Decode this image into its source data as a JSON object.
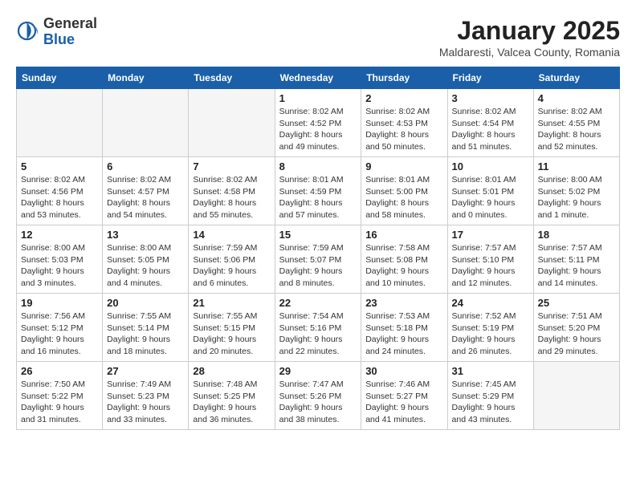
{
  "header": {
    "logo_general": "General",
    "logo_blue": "Blue",
    "month_title": "January 2025",
    "location": "Maldaresti, Valcea County, Romania"
  },
  "weekdays": [
    "Sunday",
    "Monday",
    "Tuesday",
    "Wednesday",
    "Thursday",
    "Friday",
    "Saturday"
  ],
  "weeks": [
    [
      {
        "day": "",
        "info": ""
      },
      {
        "day": "",
        "info": ""
      },
      {
        "day": "",
        "info": ""
      },
      {
        "day": "1",
        "info": "Sunrise: 8:02 AM\nSunset: 4:52 PM\nDaylight: 8 hours\nand 49 minutes."
      },
      {
        "day": "2",
        "info": "Sunrise: 8:02 AM\nSunset: 4:53 PM\nDaylight: 8 hours\nand 50 minutes."
      },
      {
        "day": "3",
        "info": "Sunrise: 8:02 AM\nSunset: 4:54 PM\nDaylight: 8 hours\nand 51 minutes."
      },
      {
        "day": "4",
        "info": "Sunrise: 8:02 AM\nSunset: 4:55 PM\nDaylight: 8 hours\nand 52 minutes."
      }
    ],
    [
      {
        "day": "5",
        "info": "Sunrise: 8:02 AM\nSunset: 4:56 PM\nDaylight: 8 hours\nand 53 minutes."
      },
      {
        "day": "6",
        "info": "Sunrise: 8:02 AM\nSunset: 4:57 PM\nDaylight: 8 hours\nand 54 minutes."
      },
      {
        "day": "7",
        "info": "Sunrise: 8:02 AM\nSunset: 4:58 PM\nDaylight: 8 hours\nand 55 minutes."
      },
      {
        "day": "8",
        "info": "Sunrise: 8:01 AM\nSunset: 4:59 PM\nDaylight: 8 hours\nand 57 minutes."
      },
      {
        "day": "9",
        "info": "Sunrise: 8:01 AM\nSunset: 5:00 PM\nDaylight: 8 hours\nand 58 minutes."
      },
      {
        "day": "10",
        "info": "Sunrise: 8:01 AM\nSunset: 5:01 PM\nDaylight: 9 hours\nand 0 minutes."
      },
      {
        "day": "11",
        "info": "Sunrise: 8:00 AM\nSunset: 5:02 PM\nDaylight: 9 hours\nand 1 minute."
      }
    ],
    [
      {
        "day": "12",
        "info": "Sunrise: 8:00 AM\nSunset: 5:03 PM\nDaylight: 9 hours\nand 3 minutes."
      },
      {
        "day": "13",
        "info": "Sunrise: 8:00 AM\nSunset: 5:05 PM\nDaylight: 9 hours\nand 4 minutes."
      },
      {
        "day": "14",
        "info": "Sunrise: 7:59 AM\nSunset: 5:06 PM\nDaylight: 9 hours\nand 6 minutes."
      },
      {
        "day": "15",
        "info": "Sunrise: 7:59 AM\nSunset: 5:07 PM\nDaylight: 9 hours\nand 8 minutes."
      },
      {
        "day": "16",
        "info": "Sunrise: 7:58 AM\nSunset: 5:08 PM\nDaylight: 9 hours\nand 10 minutes."
      },
      {
        "day": "17",
        "info": "Sunrise: 7:57 AM\nSunset: 5:10 PM\nDaylight: 9 hours\nand 12 minutes."
      },
      {
        "day": "18",
        "info": "Sunrise: 7:57 AM\nSunset: 5:11 PM\nDaylight: 9 hours\nand 14 minutes."
      }
    ],
    [
      {
        "day": "19",
        "info": "Sunrise: 7:56 AM\nSunset: 5:12 PM\nDaylight: 9 hours\nand 16 minutes."
      },
      {
        "day": "20",
        "info": "Sunrise: 7:55 AM\nSunset: 5:14 PM\nDaylight: 9 hours\nand 18 minutes."
      },
      {
        "day": "21",
        "info": "Sunrise: 7:55 AM\nSunset: 5:15 PM\nDaylight: 9 hours\nand 20 minutes."
      },
      {
        "day": "22",
        "info": "Sunrise: 7:54 AM\nSunset: 5:16 PM\nDaylight: 9 hours\nand 22 minutes."
      },
      {
        "day": "23",
        "info": "Sunrise: 7:53 AM\nSunset: 5:18 PM\nDaylight: 9 hours\nand 24 minutes."
      },
      {
        "day": "24",
        "info": "Sunrise: 7:52 AM\nSunset: 5:19 PM\nDaylight: 9 hours\nand 26 minutes."
      },
      {
        "day": "25",
        "info": "Sunrise: 7:51 AM\nSunset: 5:20 PM\nDaylight: 9 hours\nand 29 minutes."
      }
    ],
    [
      {
        "day": "26",
        "info": "Sunrise: 7:50 AM\nSunset: 5:22 PM\nDaylight: 9 hours\nand 31 minutes."
      },
      {
        "day": "27",
        "info": "Sunrise: 7:49 AM\nSunset: 5:23 PM\nDaylight: 9 hours\nand 33 minutes."
      },
      {
        "day": "28",
        "info": "Sunrise: 7:48 AM\nSunset: 5:25 PM\nDaylight: 9 hours\nand 36 minutes."
      },
      {
        "day": "29",
        "info": "Sunrise: 7:47 AM\nSunset: 5:26 PM\nDaylight: 9 hours\nand 38 minutes."
      },
      {
        "day": "30",
        "info": "Sunrise: 7:46 AM\nSunset: 5:27 PM\nDaylight: 9 hours\nand 41 minutes."
      },
      {
        "day": "31",
        "info": "Sunrise: 7:45 AM\nSunset: 5:29 PM\nDaylight: 9 hours\nand 43 minutes."
      },
      {
        "day": "",
        "info": ""
      }
    ]
  ]
}
